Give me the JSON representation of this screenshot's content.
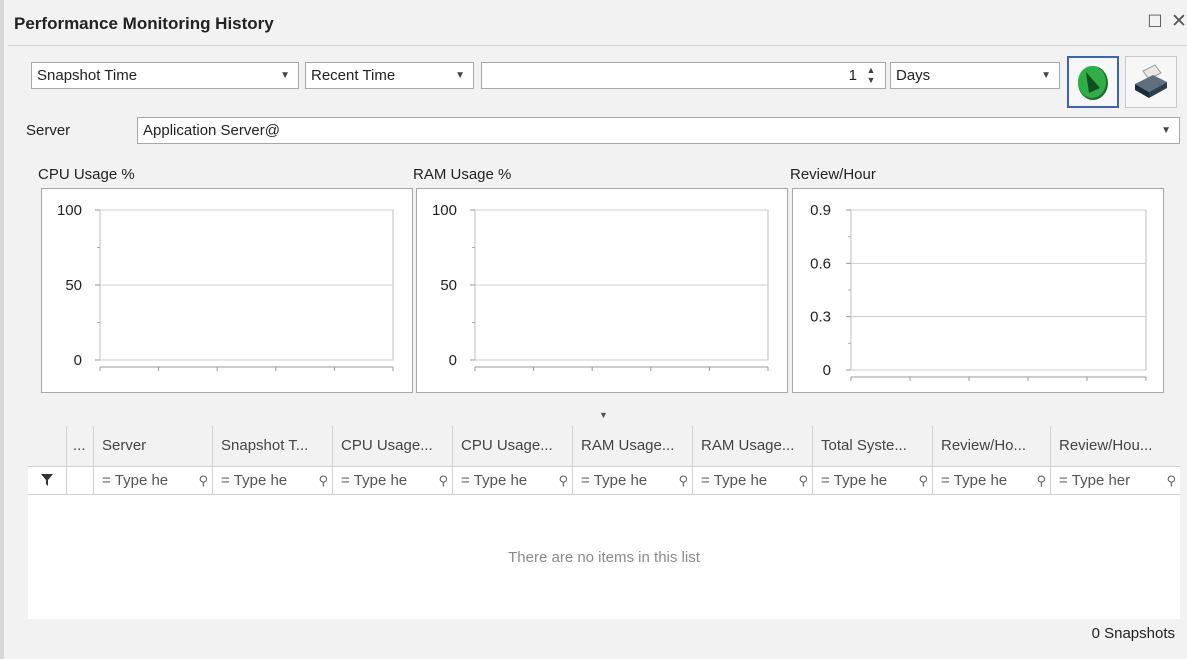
{
  "window": {
    "title": "Performance Monitoring History",
    "restore_icon": "restore-icon",
    "close_icon": "close-icon"
  },
  "toolbar": {
    "time_field": "Snapshot Time",
    "time_mode": "Recent Time",
    "amount": "1",
    "unit": "Days",
    "run_icon": "run-query-icon",
    "print_icon": "print-icon"
  },
  "server": {
    "label": "Server",
    "value": "Application Server@"
  },
  "charts": {
    "cpu_title": "CPU Usage %",
    "ram_title": "RAM Usage %",
    "review_title": "Review/Hour"
  },
  "chart_data": [
    {
      "type": "line",
      "title": "CPU Usage %",
      "xlabel": "",
      "ylabel": "",
      "ylim": [
        0,
        100
      ],
      "yticks": [
        "100",
        "50",
        "0"
      ],
      "series": [],
      "grid": true
    },
    {
      "type": "line",
      "title": "RAM Usage %",
      "xlabel": "",
      "ylabel": "",
      "ylim": [
        0,
        100
      ],
      "yticks": [
        "100",
        "50",
        "0"
      ],
      "series": [],
      "grid": true
    },
    {
      "type": "line",
      "title": "Review/Hour",
      "xlabel": "",
      "ylabel": "",
      "ylim": [
        0,
        0.9
      ],
      "yticks": [
        "0.9",
        "0.6",
        "0.3",
        "0"
      ],
      "series": [],
      "grid": true
    }
  ],
  "grid": {
    "columns": [
      "...",
      "Server",
      "Snapshot T...",
      "CPU Usage...",
      "CPU Usage...",
      "RAM Usage...",
      "RAM Usage...",
      "Total Syste...",
      "Review/Ho...",
      "Review/Hou..."
    ],
    "filter_placeholder": "Type he",
    "filter_placeholder_last": "Type her",
    "empty_message": "There are no items in this list",
    "footer": "0 Snapshots"
  }
}
